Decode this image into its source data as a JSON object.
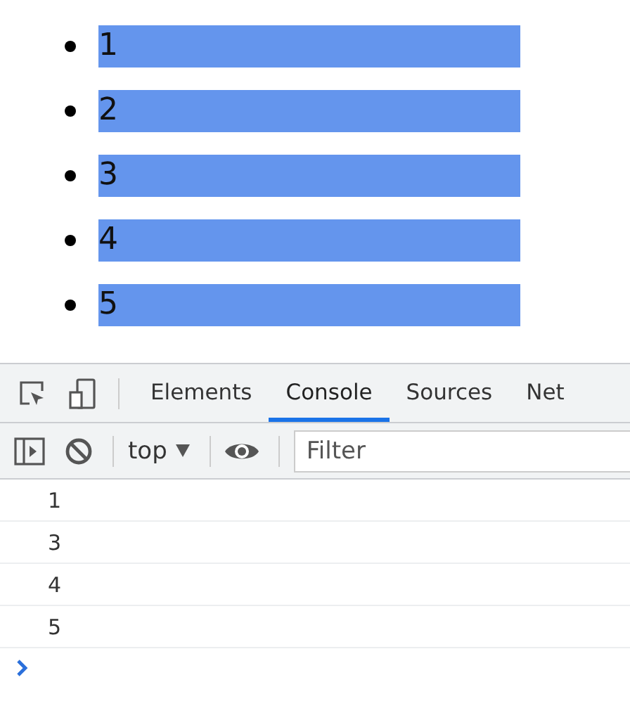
{
  "list_items": [
    {
      "text": "1"
    },
    {
      "text": "2"
    },
    {
      "text": "3"
    },
    {
      "text": "4"
    },
    {
      "text": "5"
    }
  ],
  "devtools": {
    "tabs": [
      {
        "label": "Elements",
        "selected": false
      },
      {
        "label": "Console",
        "selected": true
      },
      {
        "label": "Sources",
        "selected": false
      },
      {
        "label": "Net",
        "selected": false
      }
    ],
    "context": "top",
    "filter": {
      "placeholder": "Filter"
    },
    "messages": [
      "1",
      "3",
      "4",
      "5"
    ]
  }
}
